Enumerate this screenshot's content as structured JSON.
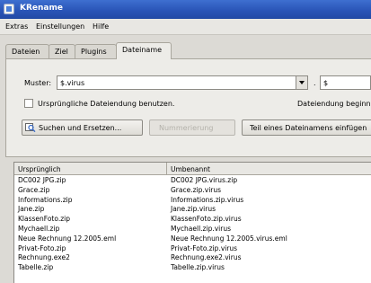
{
  "window": {
    "title": "KRename"
  },
  "menu": {
    "items": [
      "Extras",
      "Einstellungen",
      "Hilfe"
    ]
  },
  "tabs": [
    "Dateien",
    "Ziel",
    "Plugins",
    "Dateiname"
  ],
  "filename": {
    "pattern_label": "Muster:",
    "pattern_value": "$.virus",
    "dot": ".",
    "extension_value": "$",
    "checkbox_label": "Ursprüngliche Dateiendung benutzen.",
    "ending_label": "Dateiendung beginn",
    "search_button": "Suchen und Ersetzen...",
    "disabled_button": "Nummerierung",
    "part_button": "Teil eines Dateinamens einfügen"
  },
  "list": {
    "columns": [
      "Ursprünglich",
      "Umbenannt"
    ],
    "rows": [
      {
        "original": "DC002 JPG.zip",
        "renamed": "DC002 JPG.virus.zip"
      },
      {
        "original": "Grace.zip",
        "renamed": "Grace.zip.virus"
      },
      {
        "original": "Informations.zip",
        "renamed": "Informations.zip.virus"
      },
      {
        "original": "Jane.zip",
        "renamed": "Jane.zip.virus"
      },
      {
        "original": "KlassenFoto.zip",
        "renamed": "KlassenFoto.zip.virus"
      },
      {
        "original": "Mychaell.zip",
        "renamed": "Mychaell.zip.virus"
      },
      {
        "original": "Neue Rechnung 12.2005.eml",
        "renamed": "Neue Rechnung 12.2005.virus.eml"
      },
      {
        "original": "Privat-Foto.zip",
        "renamed": "Privat-Foto.zip.virus"
      },
      {
        "original": "Rechnung.exe2",
        "renamed": "Rechnung.exe2.virus"
      },
      {
        "original": "Tabelle.zip",
        "renamed": "Tabelle.zip.virus"
      }
    ]
  },
  "colors": {
    "titlebar": "#2a55b8",
    "chrome": "#dcdad5"
  }
}
